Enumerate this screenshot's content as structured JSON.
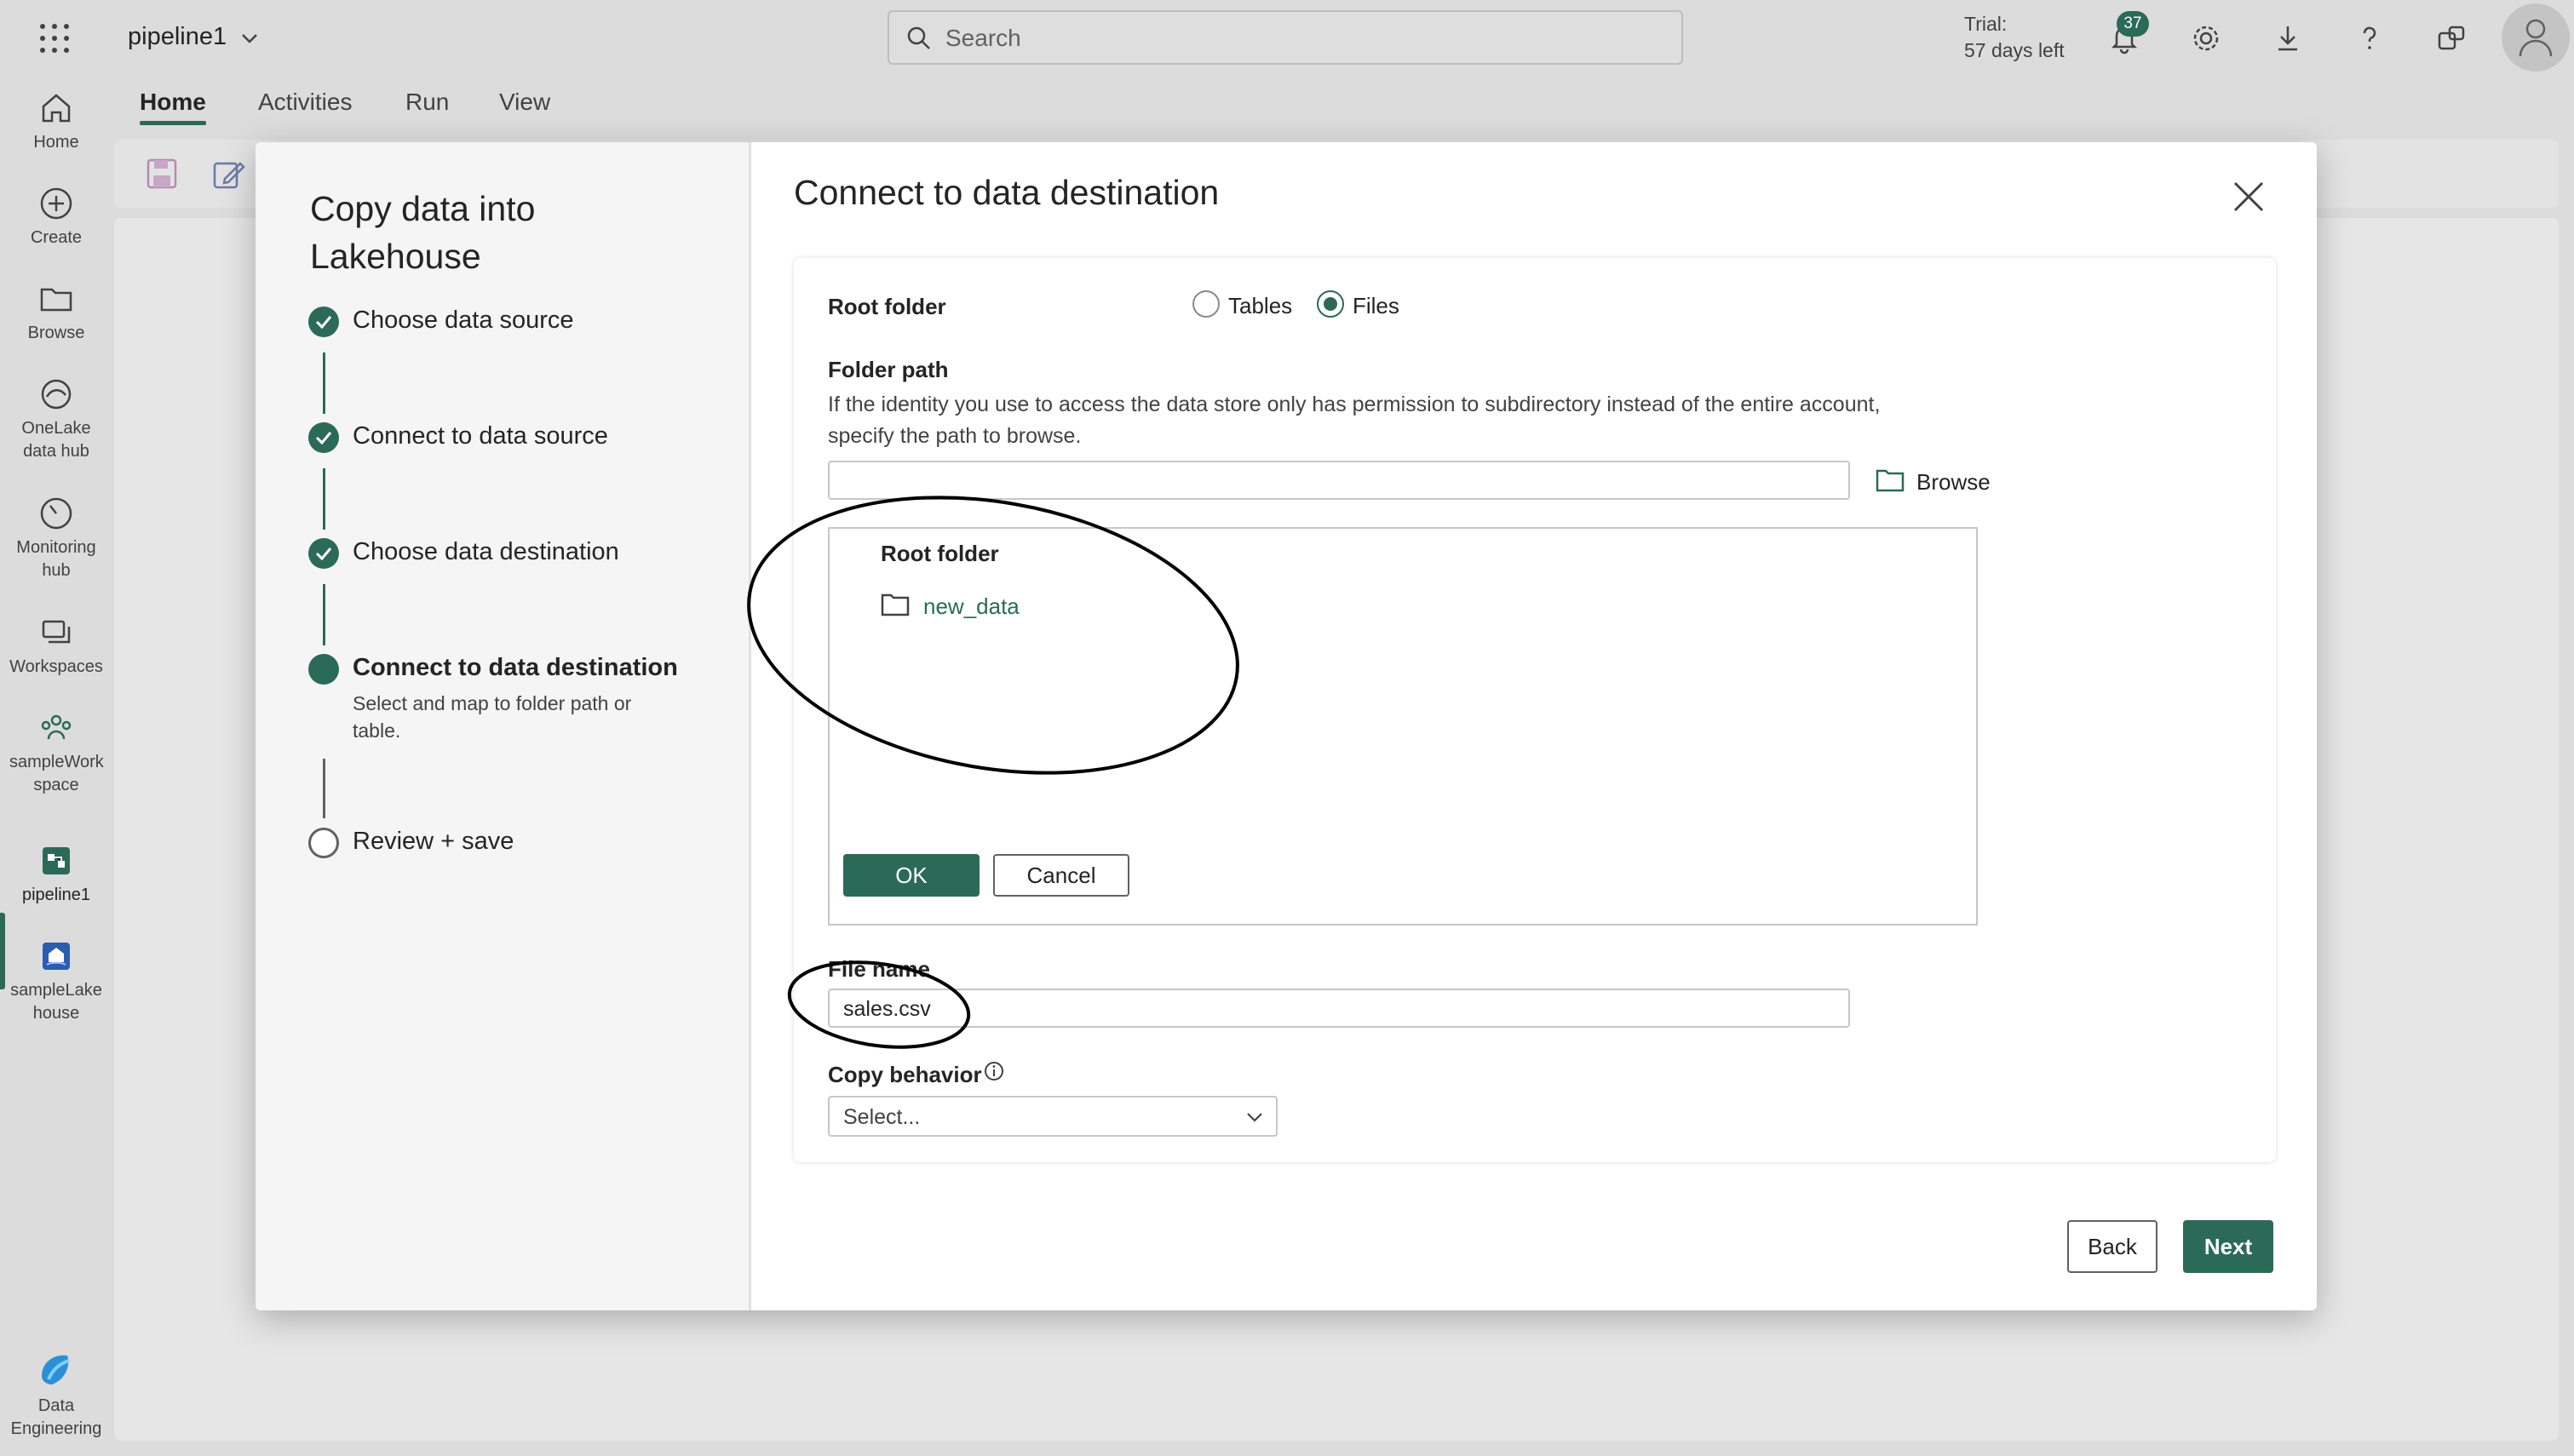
{
  "topbar": {
    "app_name": "pipeline1",
    "search_placeholder": "Search",
    "trial_line1": "Trial:",
    "trial_line2": "57 days left",
    "notifications_count": "37"
  },
  "rail": {
    "items": [
      {
        "label": "Home",
        "icon": "home-icon"
      },
      {
        "label": "Create",
        "icon": "create-icon"
      },
      {
        "label": "Browse",
        "icon": "folder-icon"
      },
      {
        "label": "OneLake data hub",
        "icon": "onelake-icon"
      },
      {
        "label": "Monitoring hub",
        "icon": "monitoring-icon"
      },
      {
        "label": "Workspaces",
        "icon": "workspaces-icon"
      },
      {
        "label": "sampleWork space",
        "icon": "people-icon"
      },
      {
        "label": "pipeline1",
        "icon": "pipeline-icon"
      },
      {
        "label": "sampleLake house",
        "icon": "lakehouse-icon"
      },
      {
        "label": "Data Engineering",
        "icon": "data-engineering-icon"
      }
    ],
    "selected": "pipeline1"
  },
  "ribbon": {
    "tabs": [
      "Home",
      "Activities",
      "Run",
      "View"
    ],
    "active_tab": "Home"
  },
  "wizard": {
    "title": "Copy data into Lakehouse",
    "steps": [
      {
        "label": "Choose data source",
        "state": "done"
      },
      {
        "label": "Connect to data source",
        "state": "done"
      },
      {
        "label": "Choose data destination",
        "state": "done"
      },
      {
        "label": "Connect to data destination",
        "state": "current",
        "description": "Select and map to folder path or table."
      },
      {
        "label": "Review + save",
        "state": "todo"
      }
    ]
  },
  "dialog": {
    "title": "Connect to data destination",
    "root_folder_label": "Root folder",
    "root_folder_options": [
      "Tables",
      "Files"
    ],
    "root_folder_selected": "Files",
    "folder_path_label": "Folder path",
    "folder_path_help": "If the identity you use to access the data store only has permission to subdirectory instead of the entire account, specify the path to browse.",
    "folder_path_value": "",
    "browse_label": "Browse",
    "tree": {
      "root_label": "Root folder",
      "items": [
        "new_data"
      ],
      "ok_label": "OK",
      "cancel_label": "Cancel"
    },
    "file_name_label": "File name",
    "file_name_value": "sales.csv",
    "copy_behavior_label": "Copy behavior",
    "copy_behavior_value": "Select...",
    "back_label": "Back",
    "next_label": "Next"
  },
  "colors": {
    "accent": "#2b6a57",
    "backdrop": "#dcdcdc",
    "annotation_ink": "#000000"
  }
}
